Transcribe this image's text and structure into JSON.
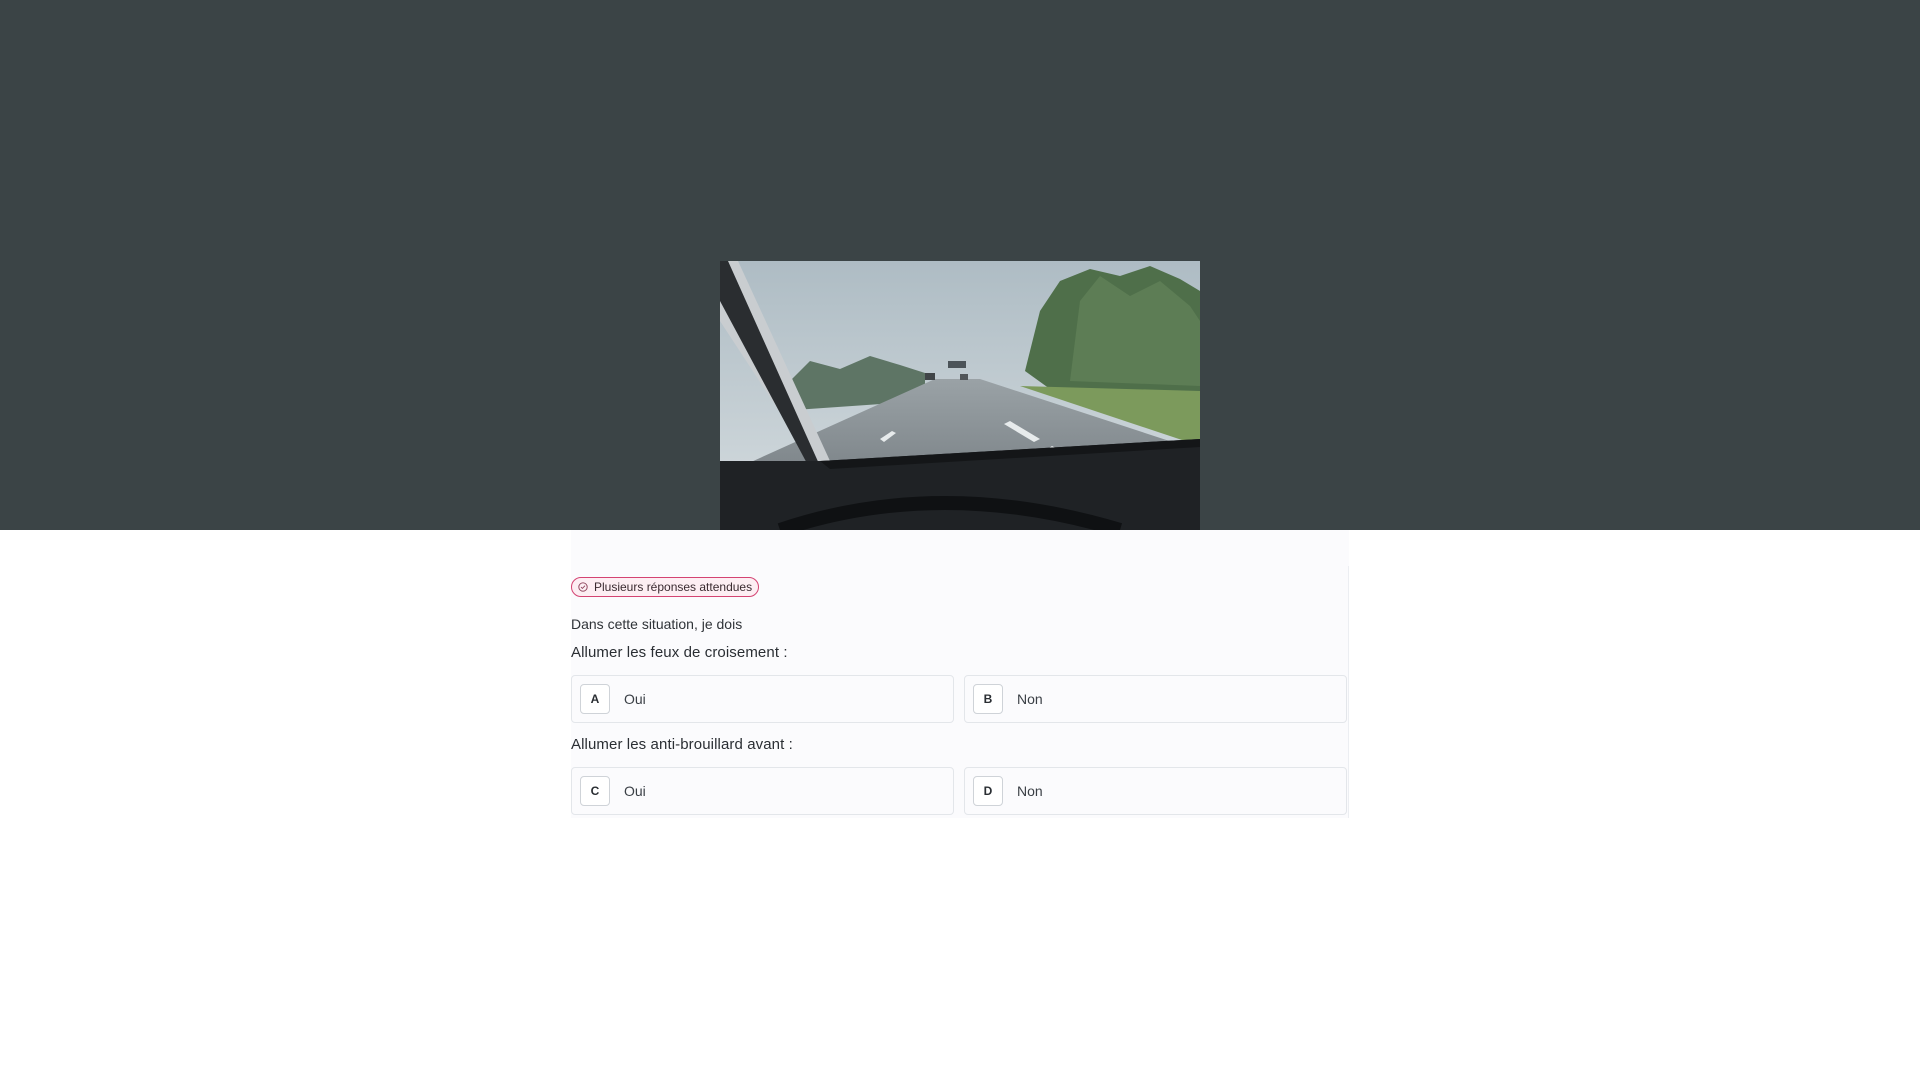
{
  "question": {
    "badge": "Plusieurs réponses attendues",
    "intro": "Dans cette situation, je dois",
    "items": [
      {
        "prompt": "Allumer les feux de croisement :",
        "options": [
          {
            "letter": "A",
            "label": "Oui"
          },
          {
            "letter": "B",
            "label": "Non"
          }
        ]
      },
      {
        "prompt": "Allumer les anti-brouillard avant :",
        "options": [
          {
            "letter": "C",
            "label": "Oui"
          },
          {
            "letter": "D",
            "label": "Non"
          }
        ]
      }
    ]
  },
  "colors": {
    "hero_background": "#3b4446",
    "badge_border": "#d44372",
    "badge_fill": "#fdeef3",
    "option_border": "#e3e6ea"
  },
  "icons": {
    "badge": "check-circle-icon"
  }
}
